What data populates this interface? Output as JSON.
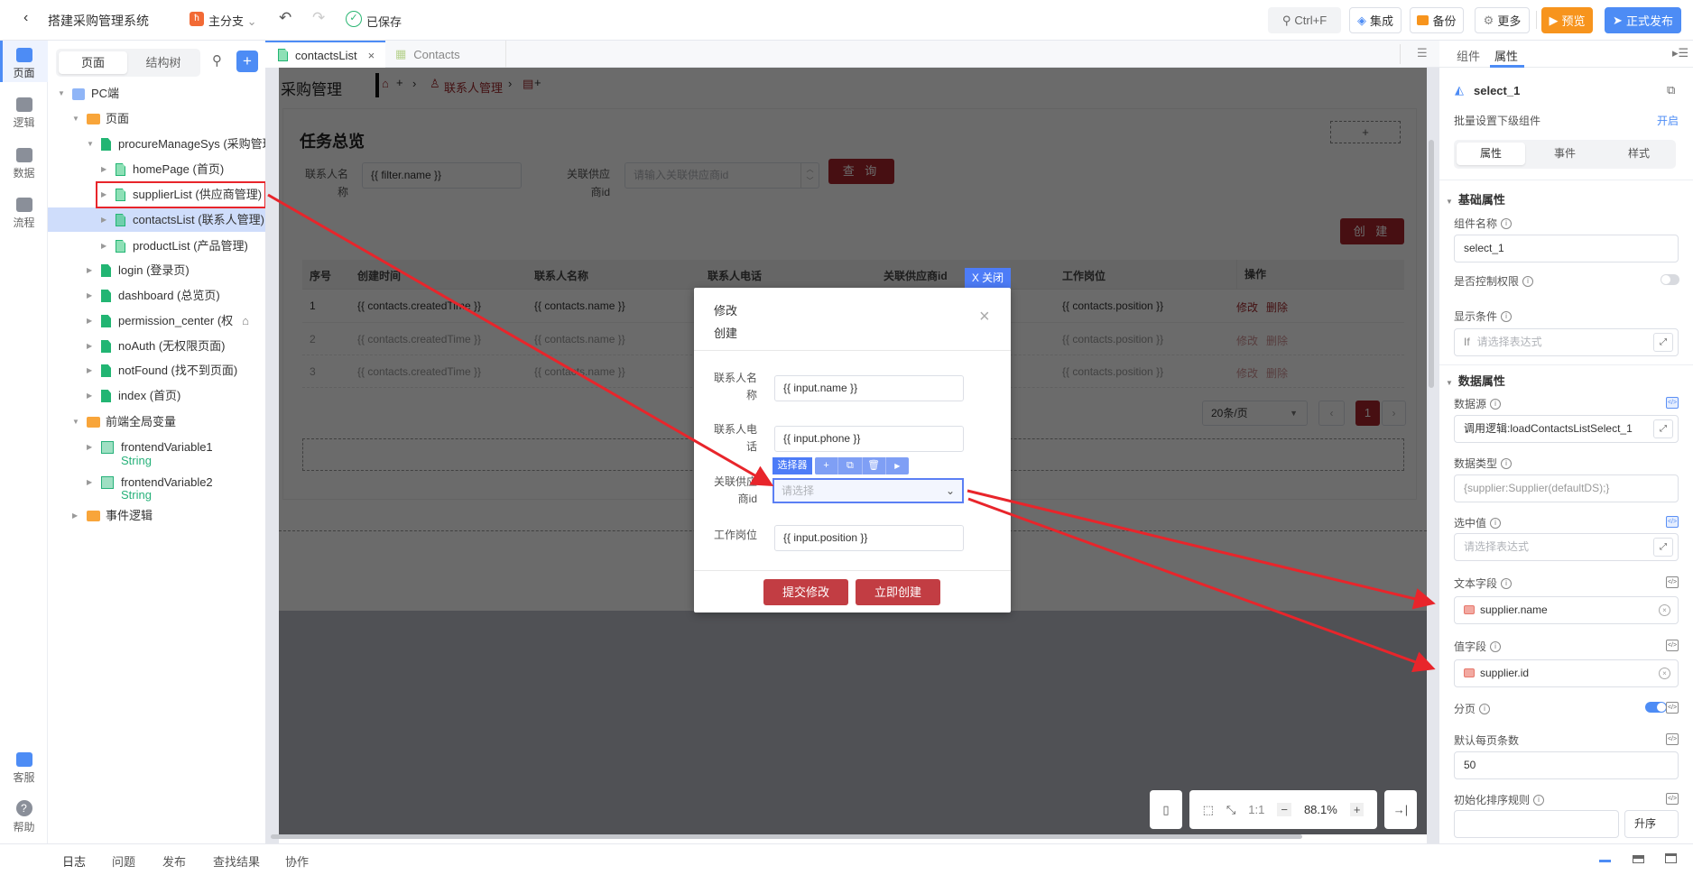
{
  "topbar": {
    "title": "搭建采购管理系统",
    "branch": "主分支",
    "saved": "已保存",
    "search_shortcut": "Ctrl+F",
    "integrate": "集成",
    "backup": "备份",
    "more": "更多",
    "preview": "预览",
    "publish": "正式发布",
    "colors": {
      "preview": "#f7941d",
      "publish": "#4d8cf5"
    }
  },
  "rail": {
    "items": [
      {
        "label": "页面",
        "icon": "layout-icon"
      },
      {
        "label": "逻辑",
        "icon": "logic-icon"
      },
      {
        "label": "数据",
        "icon": "data-icon"
      },
      {
        "label": "流程",
        "icon": "flow-icon"
      }
    ],
    "bottom": [
      {
        "label": "客服",
        "icon": "chat-icon"
      },
      {
        "label": "帮助",
        "icon": "help-icon"
      }
    ]
  },
  "tree": {
    "tabs": [
      "页面",
      "结构树"
    ],
    "items": [
      {
        "label": "PC端"
      },
      {
        "label": "页面"
      },
      {
        "label": "procureManageSys (采购管理"
      },
      {
        "label": "homePage (首页)"
      },
      {
        "label": "supplierList (供应商管理)"
      },
      {
        "label": "contactsList (联系人管理)"
      },
      {
        "label": "productList (产品管理)"
      },
      {
        "label": "login (登录页)"
      },
      {
        "label": "dashboard (总览页)"
      },
      {
        "label": "permission_center (权"
      },
      {
        "label": "noAuth (无权限页面)"
      },
      {
        "label": "notFound (找不到页面)"
      },
      {
        "label": "index (首页)"
      },
      {
        "label": "前端全局变量"
      },
      {
        "label": "frontendVariable1",
        "type": "String"
      },
      {
        "label": "frontendVariable2",
        "type": "String"
      },
      {
        "label": "事件逻辑"
      }
    ],
    "selected": "contactsList (联系人管理)"
  },
  "editor_tabs": [
    {
      "label": "contactsList"
    },
    {
      "label": "Contacts"
    }
  ],
  "page": {
    "app_title": "采购管理",
    "breadcrumb": "联系人管理",
    "section_title": "任务总览",
    "filter": {
      "name_label": "联系人名称",
      "name_value": "{{ filter.name }}",
      "supplier_label": "关联供应商id",
      "supplier_placeholder": "请输入关联供应商id",
      "query": "查 询"
    },
    "create": "创 建",
    "table": {
      "columns": [
        "序号",
        "创建时间",
        "联系人名称",
        "联系人电话",
        "关联供应商id",
        "工作岗位",
        "操作"
      ],
      "rows": [
        {
          "no": "1",
          "time": "{{ contacts.createdTime }}",
          "name": "{{ contacts.name }}",
          "position": "{{ contacts.position }}"
        },
        {
          "no": "2",
          "time": "{{ contacts.createdTime }}",
          "name": "{{ contacts.name }}",
          "position": "{{ contacts.position }}"
        },
        {
          "no": "3",
          "time": "{{ contacts.createdTime }}",
          "name": "{{ contacts.name }}",
          "position": "{{ contacts.position }}"
        }
      ],
      "actions": [
        "修改",
        "删除"
      ]
    },
    "pagination": {
      "page_size": "20条/页",
      "current": "1"
    }
  },
  "modal": {
    "close_tag": "X 关闭",
    "title1": "修改",
    "title2": "创建",
    "fields": [
      {
        "label1": "联系人名",
        "label2": "称",
        "value": "{{ input.name }}"
      },
      {
        "label1": "联系人电",
        "label2": "话",
        "value": "{{ input.phone }}"
      },
      {
        "label1": "关联供应",
        "label2": "商id",
        "placeholder": "请选择"
      },
      {
        "label1": "工作岗位",
        "value": "{{ input.position }}"
      }
    ],
    "selector_tag": "选择器",
    "submit": "提交修改",
    "create": "立即创建"
  },
  "canvas_toolbar": {
    "ratio": "1:1",
    "zoom": "88.1%"
  },
  "right": {
    "tabs": [
      "组件",
      "属性"
    ],
    "active_tab": "属性",
    "component": "select_1",
    "batch_label": "批量设置下级组件",
    "batch_action": "开启",
    "subtabs": [
      "属性",
      "事件",
      "样式"
    ],
    "basic": {
      "title": "基础属性",
      "name_label": "组件名称",
      "name_value": "select_1",
      "perm_label": "是否控制权限",
      "perm_on": false,
      "cond_label": "显示条件",
      "cond_prefix": "If",
      "cond_placeholder": "请选择表达式"
    },
    "data": {
      "title": "数据属性",
      "source_label": "数据源",
      "source_value": "调用逻辑:loadContactsListSelect_1",
      "type_label": "数据类型",
      "type_value": "{supplier:Supplier(defaultDS);}",
      "selected_label": "选中值",
      "selected_placeholder": "请选择表达式",
      "text_label": "文本字段",
      "text_value": "supplier.name",
      "value_label": "值字段",
      "value_value": "supplier.id",
      "paging_label": "分页",
      "paging_on": true,
      "pagesize_label": "默认每页条数",
      "pagesize_value": "50",
      "sort_label": "初始化排序规则",
      "sort_order": "升序"
    }
  },
  "bottom": {
    "tabs": [
      "日志",
      "问题",
      "发布",
      "查找结果",
      "协作"
    ]
  },
  "annotation_color": "#e8252b"
}
